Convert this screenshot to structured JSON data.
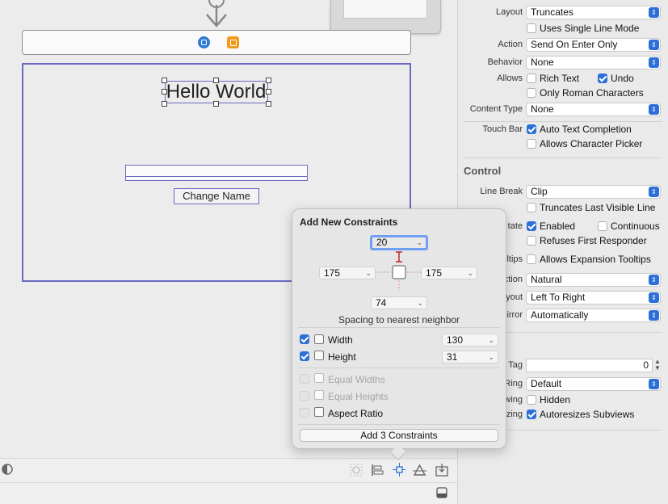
{
  "canvas": {
    "hello_label": "Hello World",
    "change_button": "Change Name"
  },
  "inspector": {
    "layout": {
      "label": "Layout",
      "value": "Truncates"
    },
    "single_line": "Uses Single Line Mode",
    "action": {
      "label": "Action",
      "value": "Send On Enter Only"
    },
    "behavior": {
      "label": "Behavior",
      "value": "None"
    },
    "allows": {
      "label": "Allows",
      "rich_text": "Rich Text",
      "undo": "Undo",
      "roman": "Only Roman Characters"
    },
    "content_type": {
      "label": "Content Type",
      "value": "None"
    },
    "touch_bar": {
      "label": "Touch Bar",
      "auto_completion": "Auto Text Completion",
      "char_picker": "Allows Character Picker"
    },
    "control_header": "Control",
    "line_break": {
      "label": "Line Break",
      "value": "Clip",
      "truncates_last": "Truncates Last Visible Line"
    },
    "state": {
      "label": "tate",
      "enabled": "Enabled",
      "continuous": "Continuous",
      "refuses": "Refuses First Responder"
    },
    "tooltips": {
      "label": "ltips",
      "value": "Allows Expansion Tooltips"
    },
    "direction": {
      "label": "ction",
      "value": "Natural"
    },
    "layout2": {
      "label": "yout",
      "value": "Left To Right"
    },
    "mirror": {
      "label": "irror",
      "value": "Automatically"
    },
    "tag": {
      "label": "Tag",
      "value": "0"
    },
    "focus_ring": {
      "label": "Ring",
      "value": "Default"
    },
    "drawing": {
      "label": "wing",
      "value": "Hidden"
    },
    "resizing": {
      "label": "zing",
      "value": "Autoresizes Subviews"
    }
  },
  "constraints": {
    "title": "Add New Constraints",
    "top": "20",
    "left": "175",
    "right": "175",
    "bottom": "74",
    "note": "Spacing to nearest neighbor",
    "width_label": "Width",
    "width_value": "130",
    "height_label": "Height",
    "height_value": "31",
    "equal_widths": "Equal Widths",
    "equal_heights": "Equal Heights",
    "aspect_ratio": "Aspect Ratio",
    "add_button": "Add 3 Constraints"
  },
  "colors": {
    "accent": "#2c6fd8",
    "selection": "#6a6ac4",
    "constraint": "#c94b4b"
  }
}
